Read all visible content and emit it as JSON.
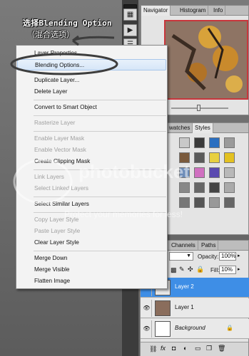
{
  "annotation": {
    "line1": "选择Blending Option",
    "line2": "（混合选项）"
  },
  "navigator_panel": {
    "tabs": [
      "Navigator",
      "Histogram",
      "Info"
    ]
  },
  "styles_panel": {
    "tabs": [
      "watches",
      "Styles"
    ]
  },
  "layers_panel": {
    "tabs": [
      "Channels",
      "Paths"
    ],
    "opacity_label": "Opacity:",
    "opacity_value": "100%",
    "fill_label": "Fill:",
    "fill_value": "10%",
    "layers": [
      {
        "name": "Layer 2",
        "selected": true
      },
      {
        "name": "Layer 1",
        "selected": false
      },
      {
        "name": "Background",
        "selected": false
      }
    ]
  },
  "context_menu": {
    "items": [
      {
        "label": "Layer Properties...",
        "disabled": false
      },
      {
        "label": "Blending Options...",
        "disabled": false,
        "highlighted": true
      },
      {
        "label": "Duplicate Layer...",
        "disabled": false
      },
      {
        "label": "Delete Layer",
        "disabled": false
      },
      {
        "label": "Convert to Smart Object",
        "disabled": false
      },
      {
        "label": "Rasterize Layer",
        "disabled": true
      },
      {
        "label": "Enable Layer Mask",
        "disabled": true
      },
      {
        "label": "Enable Vector Mask",
        "disabled": true
      },
      {
        "label": "Create Clipping Mask",
        "disabled": false
      },
      {
        "label": "Link Layers",
        "disabled": true
      },
      {
        "label": "Select Linked Layers",
        "disabled": true
      },
      {
        "label": "Select Similar Layers",
        "disabled": false
      },
      {
        "label": "Copy Layer Style",
        "disabled": true
      },
      {
        "label": "Paste Layer Style",
        "disabled": true
      },
      {
        "label": "Clear Layer Style",
        "disabled": false
      },
      {
        "label": "Merge Down",
        "disabled": false
      },
      {
        "label": "Merge Visible",
        "disabled": false
      },
      {
        "label": "Flatten Image",
        "disabled": false
      }
    ]
  },
  "watermark": {
    "text": "Protect your memories for less!"
  },
  "colors": {
    "selection_blue": "#3e8ee6",
    "navigator_frame_red": "#c8363c",
    "menu_highlight": "#d6e6f8"
  }
}
